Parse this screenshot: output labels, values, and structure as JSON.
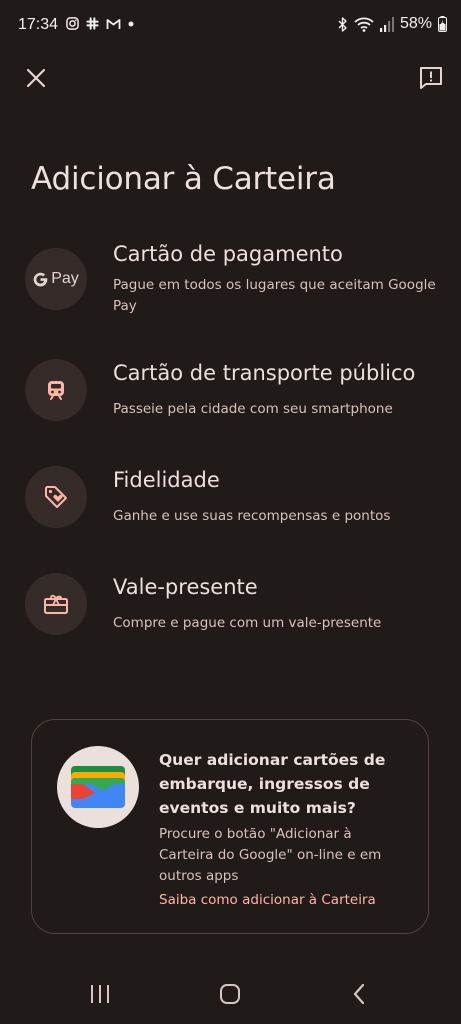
{
  "status_bar": {
    "time": "17:34",
    "battery": "58%"
  },
  "page": {
    "title": "Adicionar à Carteira"
  },
  "options": [
    {
      "title": "Cartão de pagamento",
      "description": "Pague em todos os lugares que aceitam Google Pay",
      "icon": "google-pay-icon",
      "badge_text": "Pay"
    },
    {
      "title": "Cartão de transporte público",
      "description": "Passeie pela cidade com seu smartphone",
      "icon": "train-icon"
    },
    {
      "title": "Fidelidade",
      "description": "Ganhe e use suas recompensas e pontos",
      "icon": "loyalty-tag-icon"
    },
    {
      "title": "Vale-presente",
      "description": "Compre e pague com um vale-presente",
      "icon": "gift-card-icon"
    }
  ],
  "promo": {
    "title": "Quer adicionar cartões de embarque, ingressos de eventos e muito mais?",
    "description": "Procure o botão \"Adicionar à Carteira do Google\" on-line e em outros apps",
    "link": "Saiba como adicionar à Carteira"
  },
  "colors": {
    "background": "#201a18",
    "accent_link": "#ffb4a6",
    "icon_circle": "#352c2a"
  }
}
